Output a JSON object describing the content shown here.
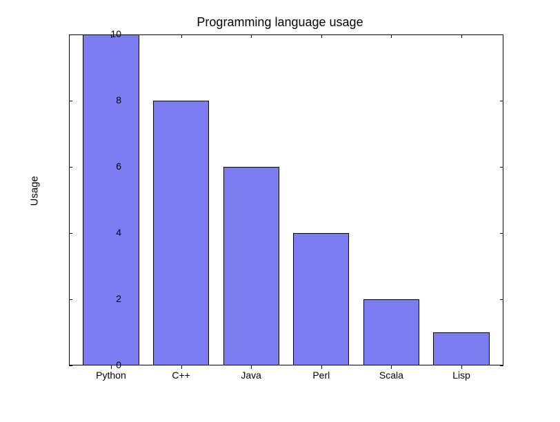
{
  "chart_data": {
    "type": "bar",
    "title": "Programming language usage",
    "ylabel": "Usage",
    "xlabel": "",
    "categories": [
      "Python",
      "C++",
      "Java",
      "Perl",
      "Scala",
      "Lisp"
    ],
    "values": [
      10,
      8,
      6,
      4,
      2,
      1
    ],
    "ylim": [
      0,
      10
    ],
    "yticks": [
      0,
      2,
      4,
      6,
      8,
      10
    ],
    "bar_color": "#7c7cf3"
  }
}
